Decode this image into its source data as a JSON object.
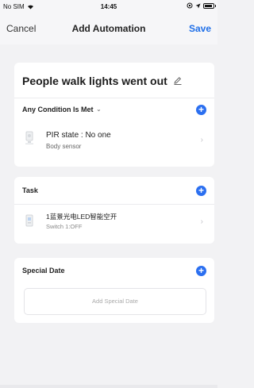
{
  "status_bar": {
    "carrier": "No SIM",
    "time": "14:45",
    "wifi_icon": "wifi-icon",
    "battery_icon": "battery-icon"
  },
  "nav": {
    "cancel_label": "Cancel",
    "title": "Add Automation",
    "save_label": "Save",
    "accent_color": "#1f6fe8"
  },
  "scene": {
    "name": "People walk lights went out",
    "edit_icon": "pencil-icon"
  },
  "conditions": {
    "header": "Any Condition Is Met",
    "items": [
      {
        "title": "PIR state : No one",
        "subtitle": "Body sensor",
        "icon": "sensor-icon"
      }
    ]
  },
  "task": {
    "header": "Task",
    "items": [
      {
        "title": "1蓝景光电LED智能空开",
        "subtitle": "Switch 1:OFF",
        "icon": "switch-icon"
      }
    ]
  },
  "special_date": {
    "header": "Special Date",
    "add_label": "Add Special Date"
  }
}
